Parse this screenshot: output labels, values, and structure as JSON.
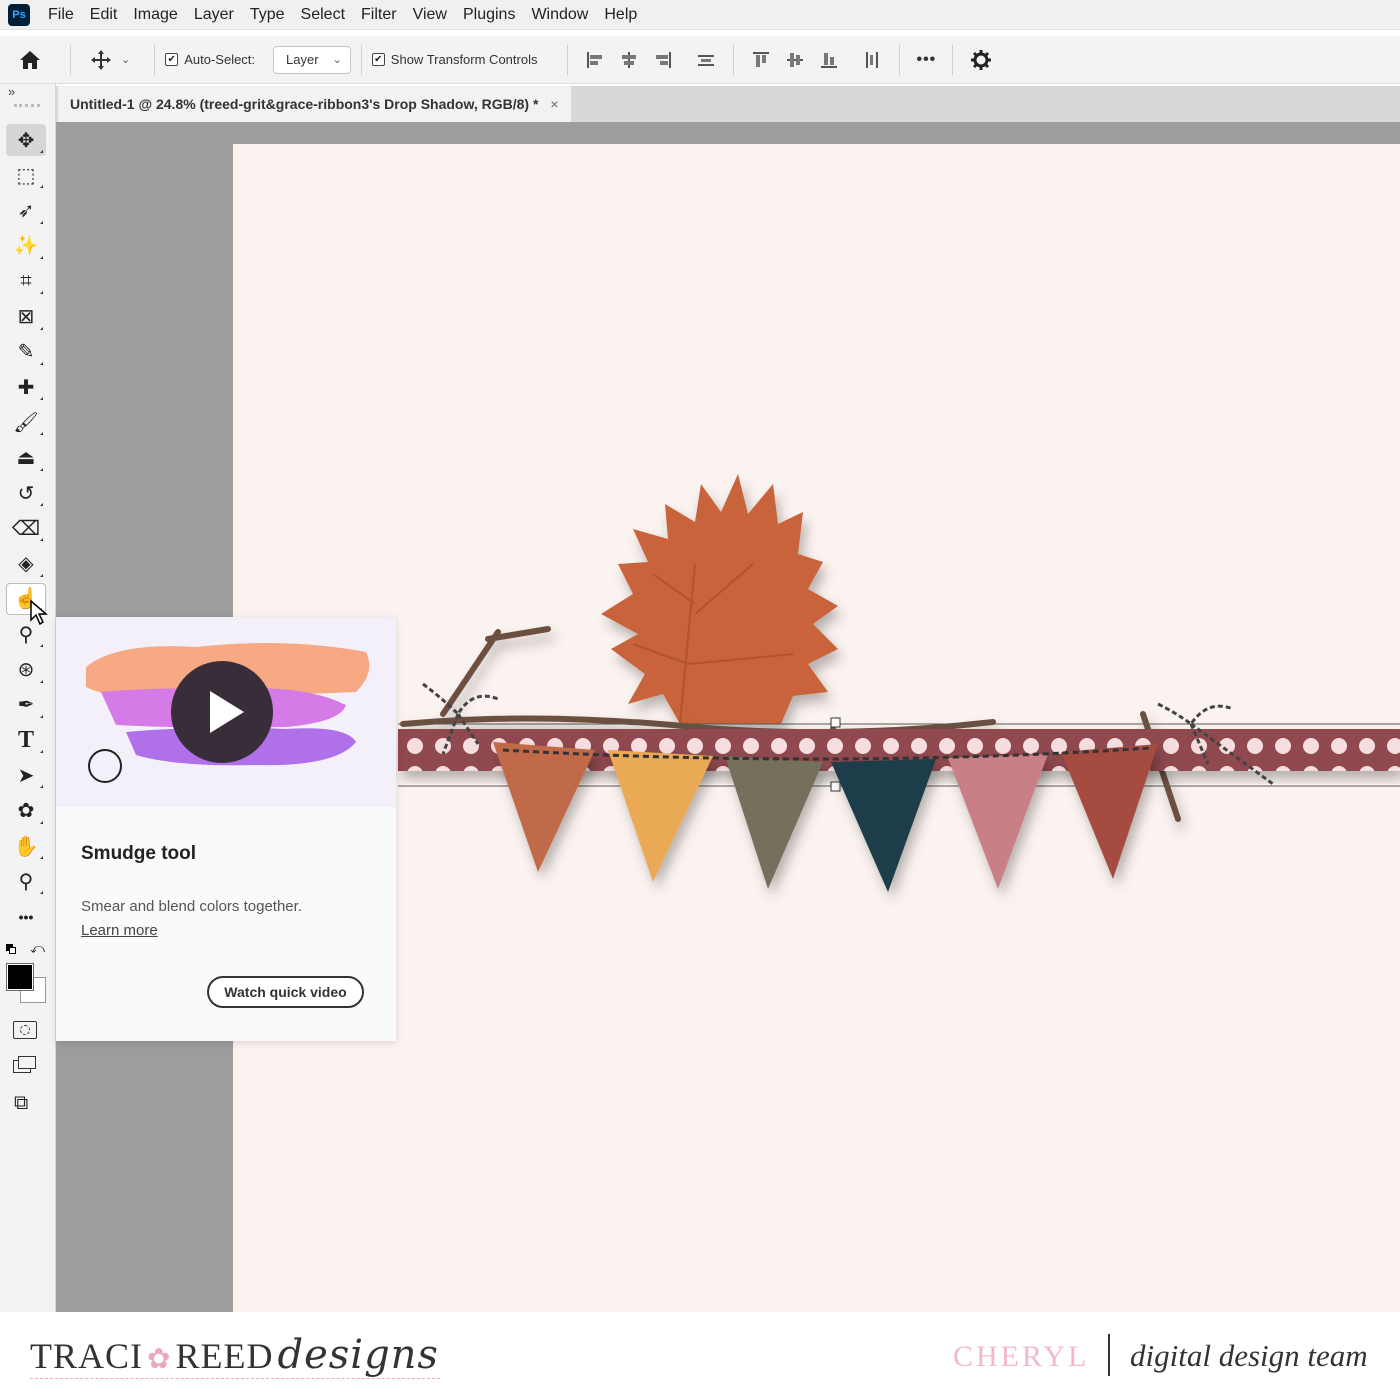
{
  "menu": {
    "logo": "Ps",
    "items": [
      "File",
      "Edit",
      "Image",
      "Layer",
      "Type",
      "Select",
      "Filter",
      "View",
      "Plugins",
      "Window",
      "Help"
    ]
  },
  "options": {
    "auto_select_label": "Auto-Select:",
    "auto_select_checked": true,
    "target_value": "Layer",
    "show_transform_label": "Show Transform Controls",
    "show_transform_checked": true,
    "more_label": "•••"
  },
  "document": {
    "tab_title": "Untitled-1 @ 24.8% (treed-grit&grace-ribbon3's Drop Shadow, RGB/8) *",
    "close_label": "×"
  },
  "toolbar": {
    "collapse_label": "»",
    "tools": [
      {
        "name": "move-tool-icon",
        "glyph": "✥",
        "state": "active"
      },
      {
        "name": "rectangular-marquee-icon",
        "glyph": "⬚"
      },
      {
        "name": "lasso-icon",
        "glyph": "➶"
      },
      {
        "name": "magic-wand-icon",
        "glyph": "✨"
      },
      {
        "name": "crop-icon",
        "glyph": "⌗"
      },
      {
        "name": "frame-icon",
        "glyph": "⊠"
      },
      {
        "name": "eyedropper-icon",
        "glyph": "✎"
      },
      {
        "name": "spot-healing-icon",
        "glyph": "✚"
      },
      {
        "name": "brush-icon",
        "glyph": "🖌"
      },
      {
        "name": "clone-stamp-icon",
        "glyph": "⏏"
      },
      {
        "name": "history-brush-icon",
        "glyph": "↺"
      },
      {
        "name": "eraser-icon",
        "glyph": "⌫"
      },
      {
        "name": "paint-bucket-icon",
        "glyph": "◈"
      },
      {
        "name": "smudge-icon",
        "glyph": "☝",
        "state": "hover"
      },
      {
        "name": "dodge-icon",
        "glyph": "⚲"
      },
      {
        "name": "content-aware-icon",
        "glyph": "⊛"
      },
      {
        "name": "pen-icon",
        "glyph": "✒"
      },
      {
        "name": "type-icon",
        "glyph": "T"
      },
      {
        "name": "path-selection-icon",
        "glyph": "➤"
      },
      {
        "name": "custom-shape-icon",
        "glyph": "✿"
      },
      {
        "name": "hand-icon",
        "glyph": "✋"
      },
      {
        "name": "zoom-icon",
        "glyph": "⚲"
      },
      {
        "name": "more-tools-icon",
        "glyph": "•••"
      }
    ]
  },
  "tooltip": {
    "title": "Smudge tool",
    "description": "Smear and blend colors together.",
    "link": "Learn more",
    "button": "Watch quick video"
  },
  "footer": {
    "brand_part1": "TRACI",
    "brand_part2": "REED",
    "brand_script": "designs",
    "designer": "CHERYL",
    "team": "digital design team"
  },
  "colors": {
    "canvas": "#fbf3ef",
    "ribbon": "#8f4a50",
    "leaf": "#c8633a",
    "pink_accent": "#f3b8cc"
  }
}
